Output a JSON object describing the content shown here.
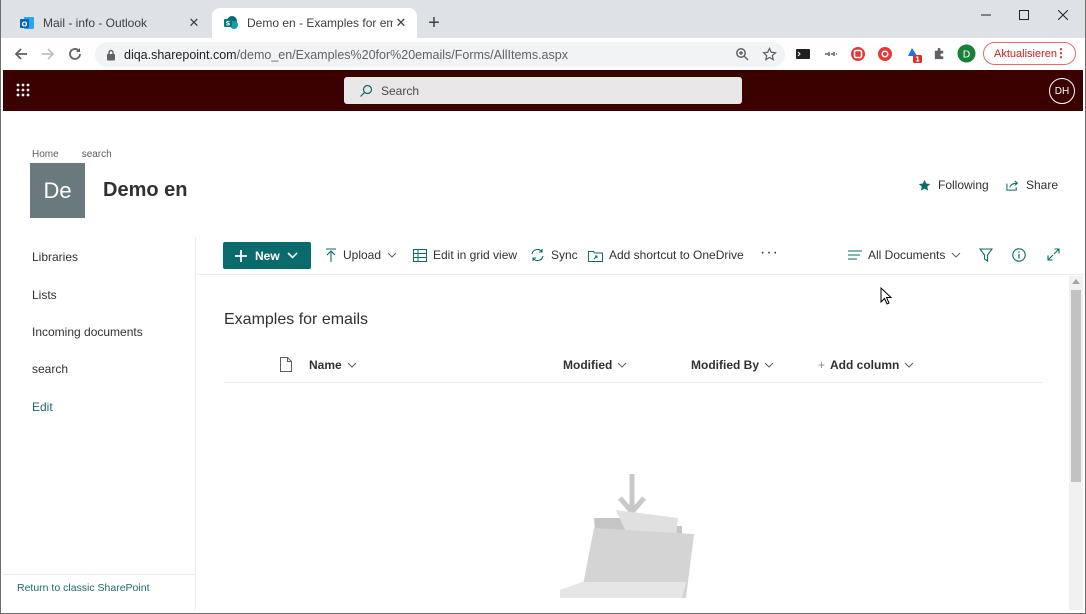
{
  "browser": {
    "tabs": [
      {
        "title": "Mail - info - Outlook",
        "active": false,
        "favicon": "outlook-icon"
      },
      {
        "title": "Demo en - Examples for emails -",
        "active": true,
        "favicon": "sharepoint-icon"
      }
    ],
    "address": {
      "host": "diqa.sharepoint.com",
      "path": "/demo_en/Examples%20for%20emails/Forms/AllItems.aspx"
    },
    "profile_initial": "D",
    "extension_badge": "1",
    "update_label": "Aktualisieren"
  },
  "suite": {
    "search_placeholder": "Search",
    "user_initials": "DH"
  },
  "site": {
    "breadcrumb": [
      "Home",
      "search"
    ],
    "logo_text": "De",
    "title": "Demo en",
    "following_label": "Following",
    "share_label": "Share"
  },
  "nav": {
    "items": [
      "Libraries",
      "Lists",
      "Incoming documents",
      "search"
    ],
    "edit_label": "Edit",
    "classic_label": "Return to classic SharePoint"
  },
  "commandbar": {
    "new_label": "New",
    "upload_label": "Upload",
    "grid_label": "Edit in grid view",
    "sync_label": "Sync",
    "shortcut_label": "Add shortcut to OneDrive",
    "view_label": "All Documents"
  },
  "library": {
    "title": "Examples for emails",
    "columns": {
      "name": "Name",
      "modified": "Modified",
      "modified_by": "Modified By",
      "add": "Add column"
    }
  },
  "colors": {
    "suite_bar": "#3b0000",
    "accent": "#0b6a6b",
    "site_logo": "#69797e"
  }
}
